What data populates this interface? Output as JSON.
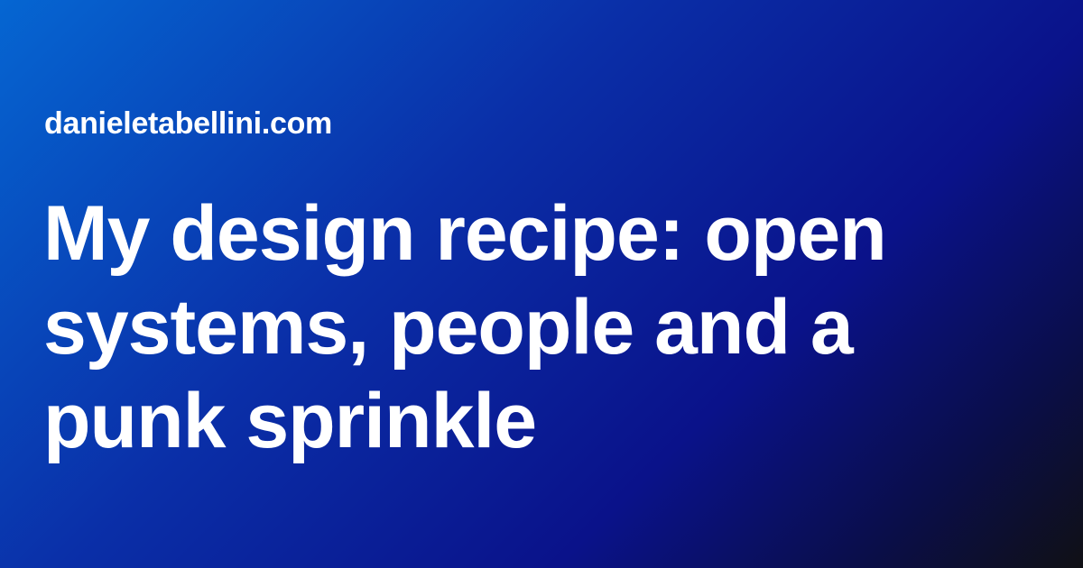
{
  "site_name": "danieletabellini.com",
  "title_lines": [
    "My design recipe: open",
    "systems, people and a",
    "punk sprinkle"
  ],
  "colors": {
    "text": "#ffffff",
    "gradient_start": "#0566d2",
    "gradient_mid": "#0a128a",
    "gradient_end": "#101015"
  }
}
